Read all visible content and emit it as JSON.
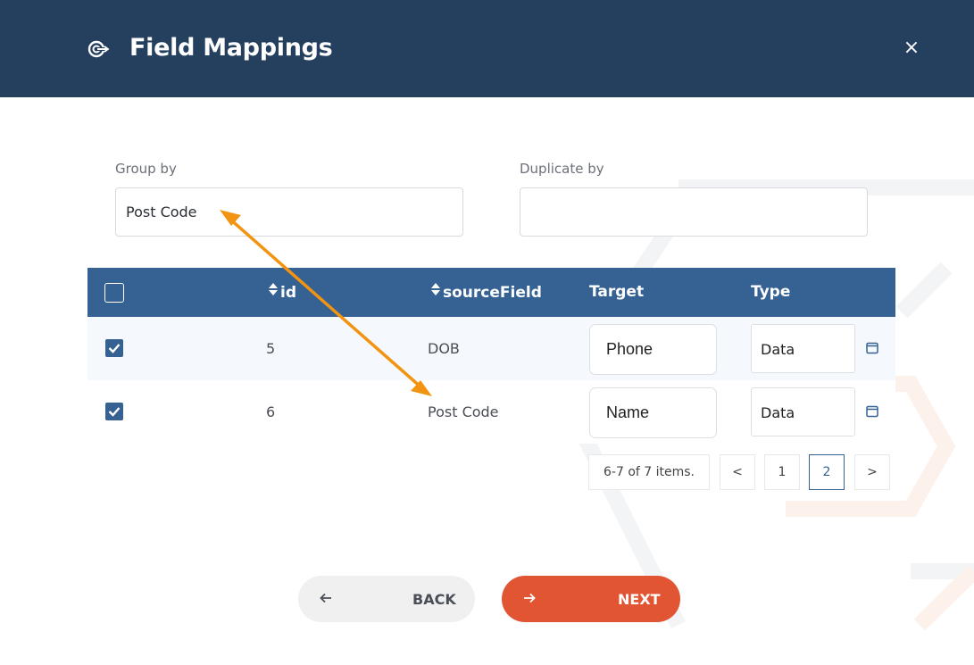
{
  "modal": {
    "title": "Field Mappings",
    "close_label": "×",
    "header_color": "#253f5f"
  },
  "form": {
    "group_by_label": "Group by",
    "group_by_value": "Post Code",
    "duplicate_by_label": "Duplicate by",
    "duplicate_by_value": ""
  },
  "table": {
    "header_color": "#356292",
    "columns": [
      "id",
      "sourceField",
      "Target",
      "Type"
    ],
    "select_all_checked": false,
    "rows": [
      {
        "checked": true,
        "id": "5",
        "sourceField": "DOB",
        "target": "Phone",
        "type": "Data"
      },
      {
        "checked": true,
        "id": "6",
        "sourceField": "Post Code",
        "target": "Name",
        "type": "Data"
      }
    ]
  },
  "pager": {
    "info": "6-7 of 7 items.",
    "prev_label": "<",
    "next_label": ">",
    "pages": [
      "1",
      "2"
    ],
    "current_page": "2"
  },
  "actions": {
    "back_label": "BACK",
    "next_label": "NEXT",
    "next_color": "#e25533"
  },
  "annotation": {
    "arrow_color": "#f39312"
  }
}
